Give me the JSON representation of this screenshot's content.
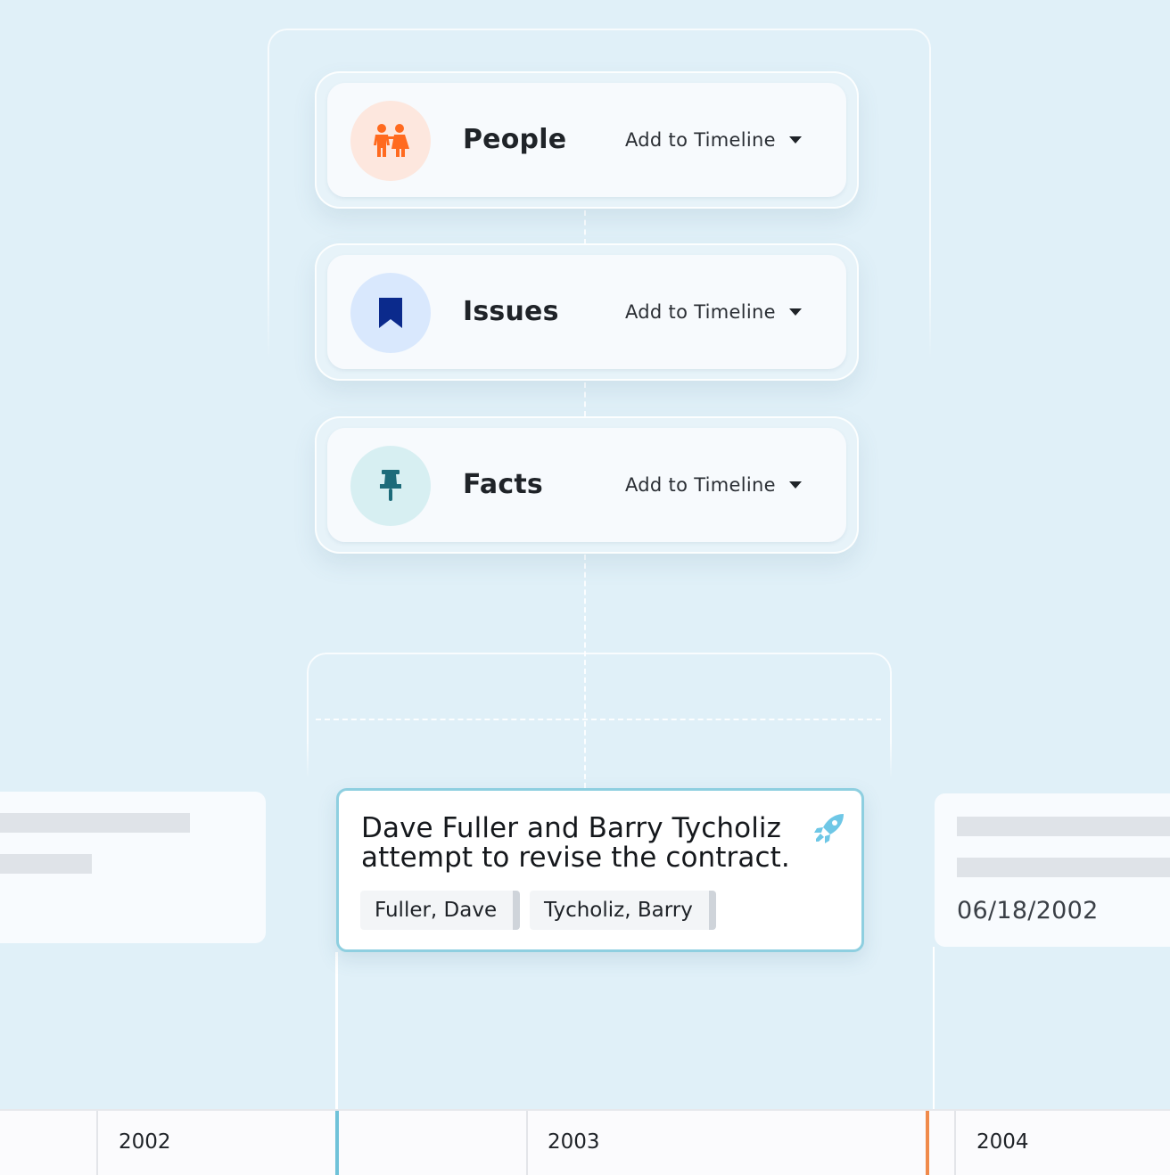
{
  "categories": [
    {
      "name": "People",
      "action": "Add to Timeline",
      "icon": "people-icon",
      "color": "#ff6a1f",
      "bg": "#fde7de"
    },
    {
      "name": "Issues",
      "action": "Add to Timeline",
      "icon": "bookmark-icon",
      "color": "#0b2a8c",
      "bg": "#d9e8fd"
    },
    {
      "name": "Facts",
      "action": "Add to Timeline",
      "icon": "pushpin-icon",
      "color": "#1d6b7a",
      "bg": "#d7eff2"
    }
  ],
  "event": {
    "title_line1": "Dave Fuller and Barry Tycholiz",
    "title_line2": "attempt to revise the contract.",
    "icon": "rocket-icon",
    "icon_color": "#6ec7e6",
    "tags": [
      "Fuller, Dave",
      "Tycholiz, Barry"
    ],
    "border_color": "#8ecfe0"
  },
  "right_card": {
    "date": "06/18/2002"
  },
  "axis": {
    "years": [
      "2002",
      "2003",
      "2004"
    ]
  },
  "markers": {
    "event_color": "#6fc2d9",
    "next_color": "#f08a4b"
  }
}
